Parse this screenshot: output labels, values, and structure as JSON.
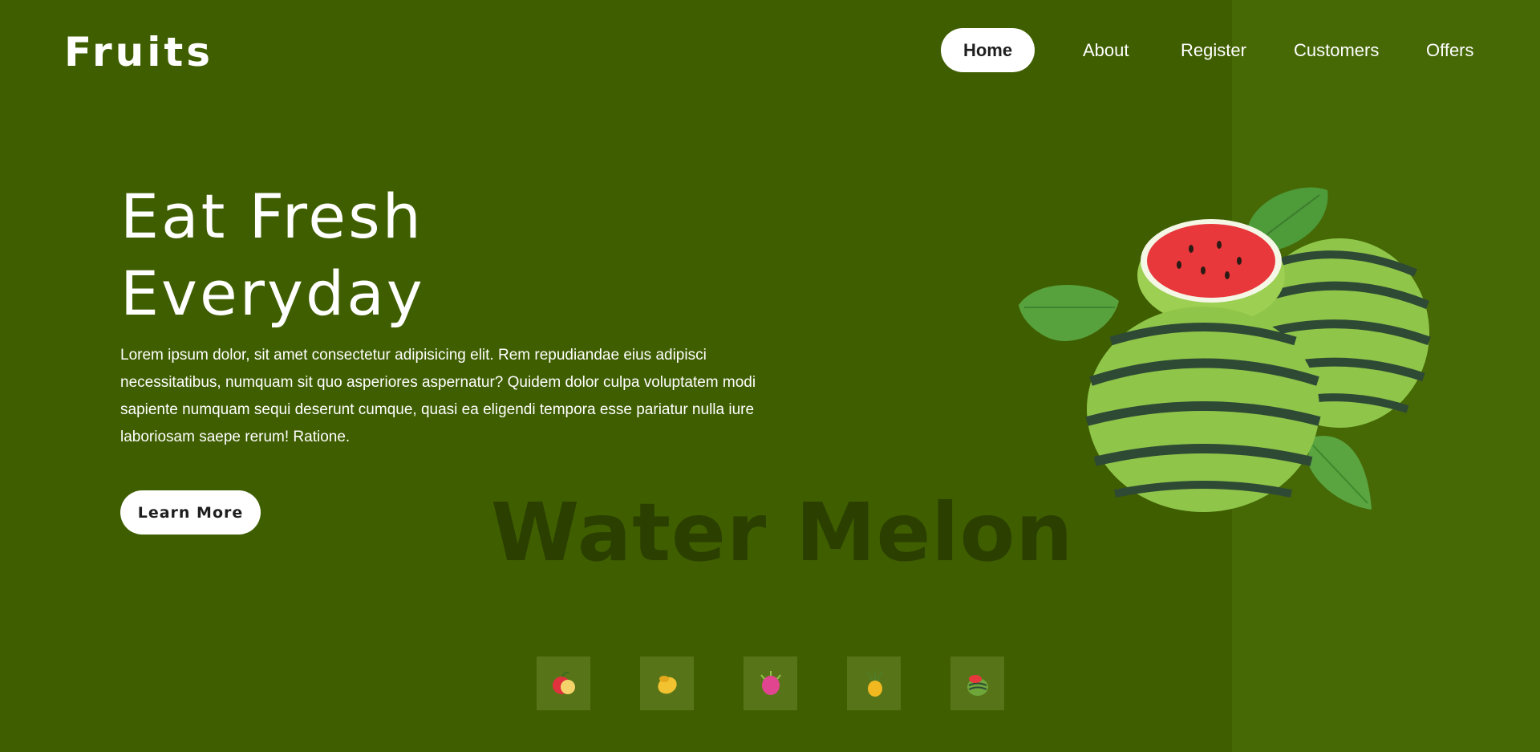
{
  "brand": {
    "logo": "Fruits"
  },
  "nav": {
    "items": [
      {
        "label": "Home",
        "active": true
      },
      {
        "label": "About",
        "active": false
      },
      {
        "label": "Register",
        "active": false
      },
      {
        "label": "Customers",
        "active": false
      },
      {
        "label": "Offers",
        "active": false
      }
    ]
  },
  "hero": {
    "title_line1": "Eat Fresh",
    "title_line2": "Everyday",
    "description": "Lorem ipsum dolor, sit amet consectetur adipisicing elit. Rem repudiandae eius adipisci necessitatibus, numquam sit quo asperiores aspernatur? Quidem dolor culpa voluptatem modi sapiente numquam sequi deserunt cumque, quasi ea eligendi tempora esse pariatur nulla iure laboriosam saepe rerum! Ratione.",
    "cta_label": "Learn More",
    "fruit_name": "Water Melon",
    "image_name": "watermelon-image"
  },
  "thumbnails": [
    {
      "name": "apple-thumbnail"
    },
    {
      "name": "mango-thumbnail"
    },
    {
      "name": "dragon-fruit-thumbnail"
    },
    {
      "name": "pineapple-thumbnail"
    },
    {
      "name": "watermelon-thumbnail"
    }
  ],
  "colors": {
    "background": "#3f5e00",
    "right_panel": "#466906",
    "fruit_name_text": "#2a3f00",
    "thumbnail_bg": "#577518"
  }
}
